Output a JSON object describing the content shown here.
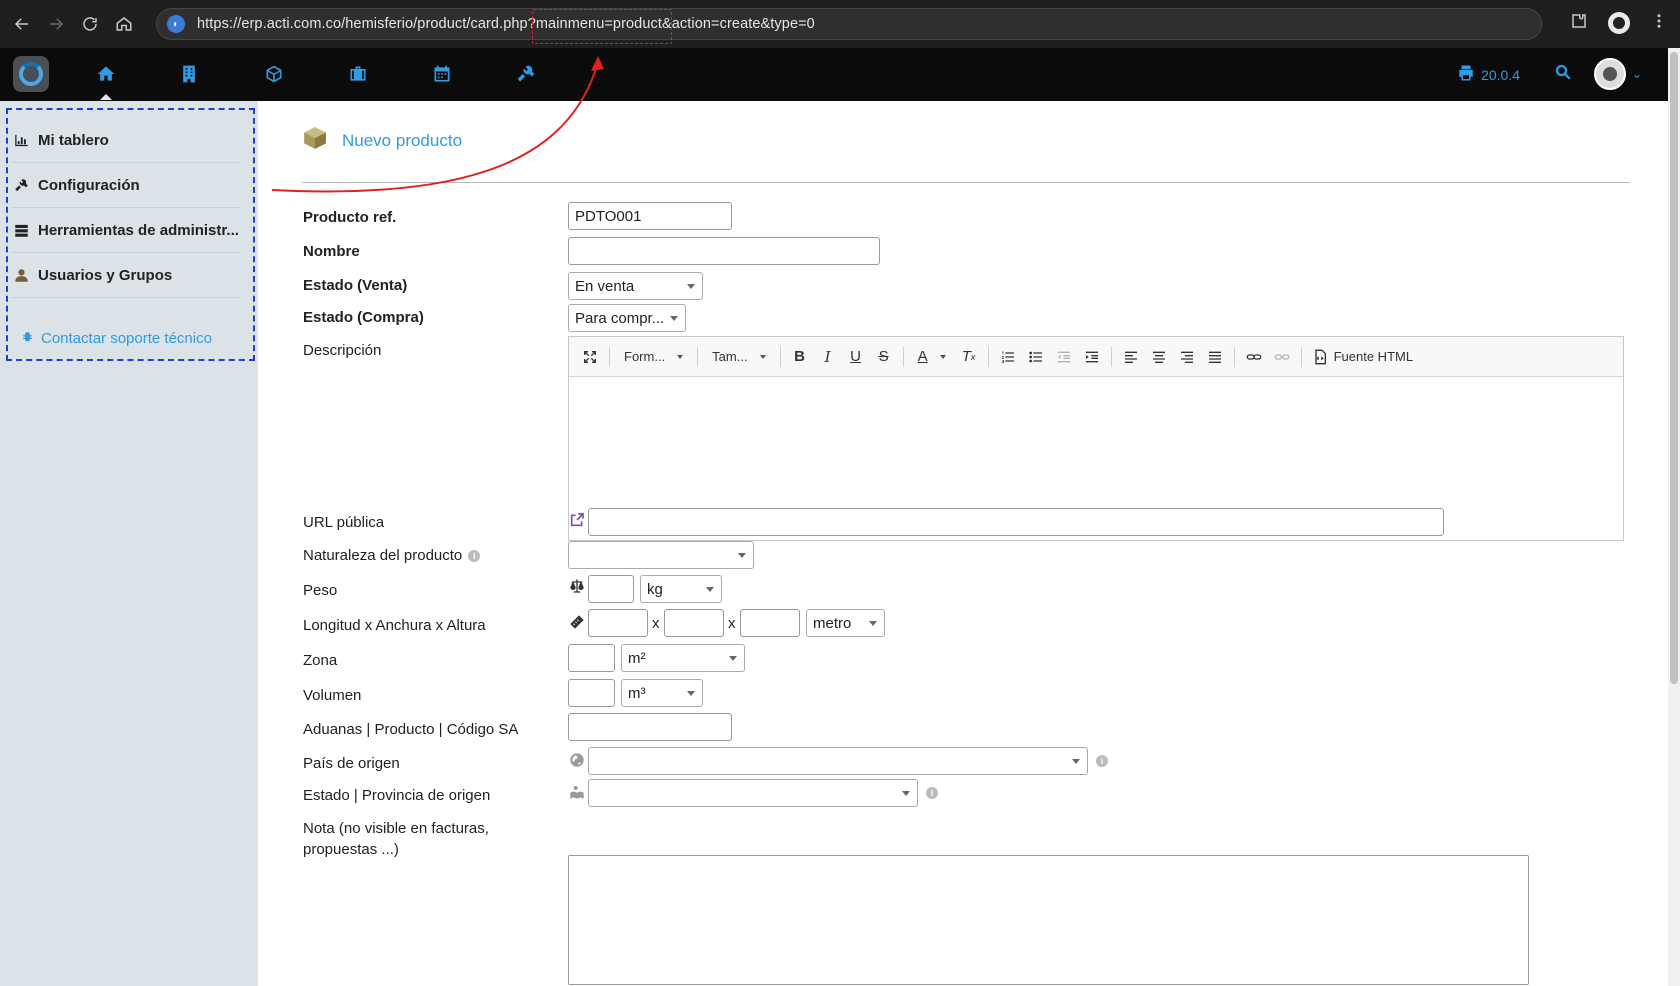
{
  "browser": {
    "url": "https://erp.acti.com.co/hemisferio/product/card.php?mainmenu=product&action=create&type=0"
  },
  "topbar": {
    "version": "20.0.4",
    "icons": [
      "home-icon",
      "building-icon",
      "cube-icon",
      "briefcase-icon",
      "calendar-icon",
      "tools-icon"
    ]
  },
  "sidebar": {
    "items": [
      {
        "label": "Mi tablero",
        "icon": "chart-icon"
      },
      {
        "label": "Configuración",
        "icon": "tools-icon"
      },
      {
        "label": "Herramientas de administr...",
        "icon": "server-icon"
      },
      {
        "label": "Usuarios y Grupos",
        "icon": "user-icon"
      }
    ],
    "support": "Contactar soporte técnico"
  },
  "page": {
    "title": "Nuevo producto"
  },
  "form": {
    "ref_label": "Producto ref.",
    "ref_value": "PDTO001",
    "name_label": "Nombre",
    "status_sell_label": "Estado (Venta)",
    "status_sell_value": "En venta",
    "status_buy_label": "Estado (Compra)",
    "status_buy_value": "Para compr...",
    "description_label": "Descripción",
    "url_label": "URL pública",
    "nature_label": "Naturaleza del producto",
    "weight_label": "Peso",
    "weight_unit": "kg",
    "dims_label": "Longitud x Anchura x Altura",
    "dims_sep": "x",
    "dims_unit": "metro",
    "area_label": "Zona",
    "area_unit": "m²",
    "volume_label": "Volumen",
    "volume_unit": "m³",
    "customs_label": "Aduanas | Producto | Código SA",
    "country_label": "País de origen",
    "state_label": "Estado | Provincia de origen",
    "note_label_1": "Nota (no visible en facturas,",
    "note_label_2": "propuestas ...)"
  },
  "editor": {
    "format": "Form...",
    "size": "Tam...",
    "source": "Fuente HTML"
  },
  "colors": {
    "accent": "#2f9be3",
    "annotation_blue": "#1e3fd4",
    "annotation_red": "#dd2222",
    "sidebar_bg": "#dbe3e8"
  }
}
